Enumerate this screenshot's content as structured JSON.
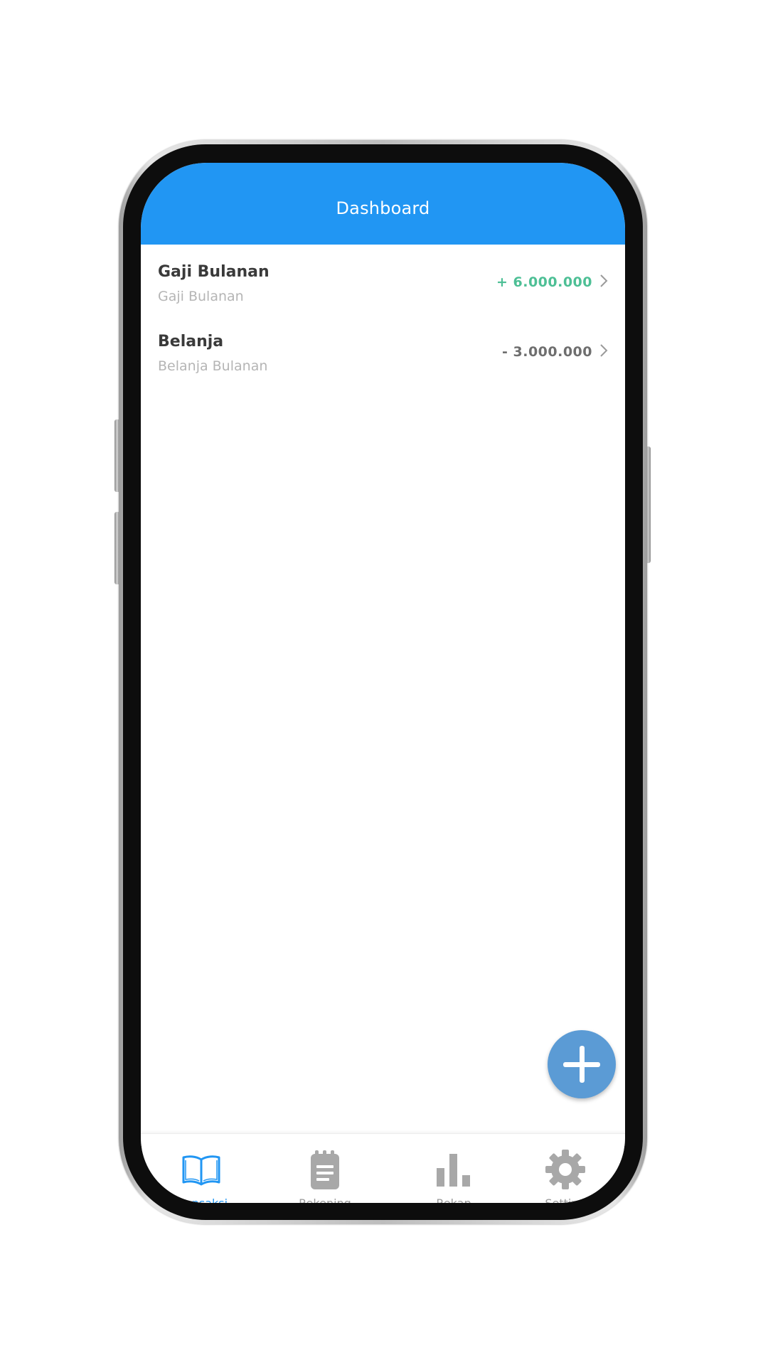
{
  "app_bar": {
    "title": "Dashboard",
    "color": "#2196f3"
  },
  "transactions": [
    {
      "title": "Gaji Bulanan",
      "subtitle": "Gaji Bulanan",
      "amount": "+ 6.000.000",
      "type": "income",
      "color": "#4dbf95"
    },
    {
      "title": "Belanja",
      "subtitle": "Belanja Bulanan",
      "amount": "- 3.000.000",
      "type": "expense",
      "color": "#6e6e6e"
    }
  ],
  "fab": {
    "icon": "plus-icon",
    "color": "#5b9bd5"
  },
  "bottom_nav": {
    "items": [
      {
        "label": "Transaksi",
        "icon": "book-open-icon",
        "active": true
      },
      {
        "label": "Rekening",
        "icon": "clipboard-icon",
        "active": false
      },
      {
        "label": "Rekap",
        "icon": "bar-chart-icon",
        "active": false
      },
      {
        "label": "Setting",
        "icon": "gear-icon",
        "active": false
      }
    ],
    "active_color": "#2196f3",
    "inactive_color": "#9a9a9a"
  }
}
